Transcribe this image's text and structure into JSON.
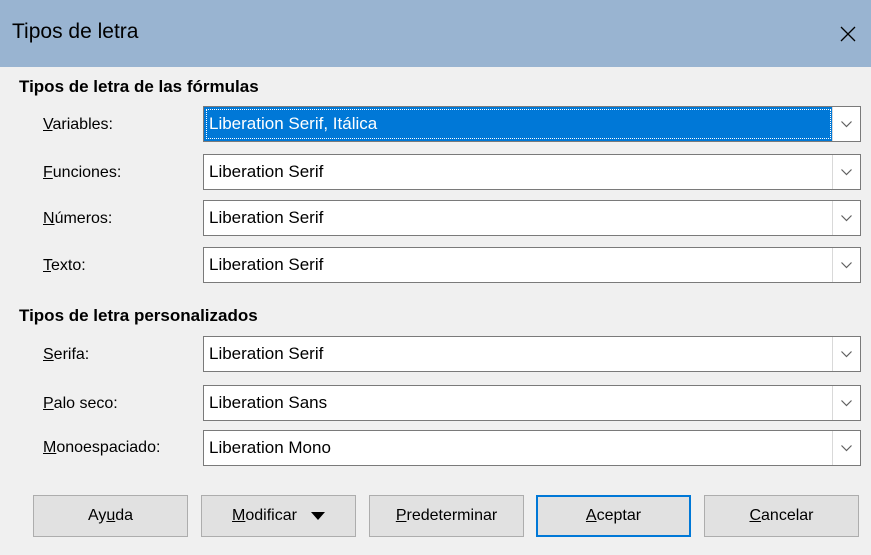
{
  "window": {
    "title": "Tipos de letra"
  },
  "formula_fonts": {
    "section_title": "Tipos de letra de las fórmulas",
    "rows": [
      {
        "label_mnemonic": "V",
        "label_rest": "ariables:",
        "value": "Liberation Serif, Itálica",
        "selected": true
      },
      {
        "label_mnemonic": "F",
        "label_rest": "unciones:",
        "value": "Liberation Serif"
      },
      {
        "label_mnemonic": "N",
        "label_rest": "úmeros:",
        "value": "Liberation Serif"
      },
      {
        "label_mnemonic": "T",
        "label_rest": "exto:",
        "value": "Liberation Serif"
      }
    ]
  },
  "custom_fonts": {
    "section_title": "Tipos de letra personalizados",
    "rows": [
      {
        "label_mnemonic": "S",
        "label_rest": "erifa:",
        "value": "Liberation Serif"
      },
      {
        "label_mnemonic": "P",
        "label_rest": "alo seco:",
        "value": "Liberation Sans"
      },
      {
        "label_mnemonic": "M",
        "label_rest": "onoespaciado:",
        "value": "Liberation Mono"
      }
    ]
  },
  "buttons": {
    "help": {
      "pre": "Ay",
      "mnemonic": "u",
      "post": "da"
    },
    "modify": {
      "pre": "",
      "mnemonic": "M",
      "post": "odificar"
    },
    "default": {
      "pre": "",
      "mnemonic": "P",
      "post": "redeterminar"
    },
    "ok": {
      "pre": "",
      "mnemonic": "A",
      "post": "ceptar"
    },
    "cancel": {
      "pre": "",
      "mnemonic": "C",
      "post": "ancelar"
    }
  },
  "colors": {
    "titlebar": "#99b4d1",
    "selection": "#0078d7",
    "dialog_bg": "#f0f0f0"
  }
}
